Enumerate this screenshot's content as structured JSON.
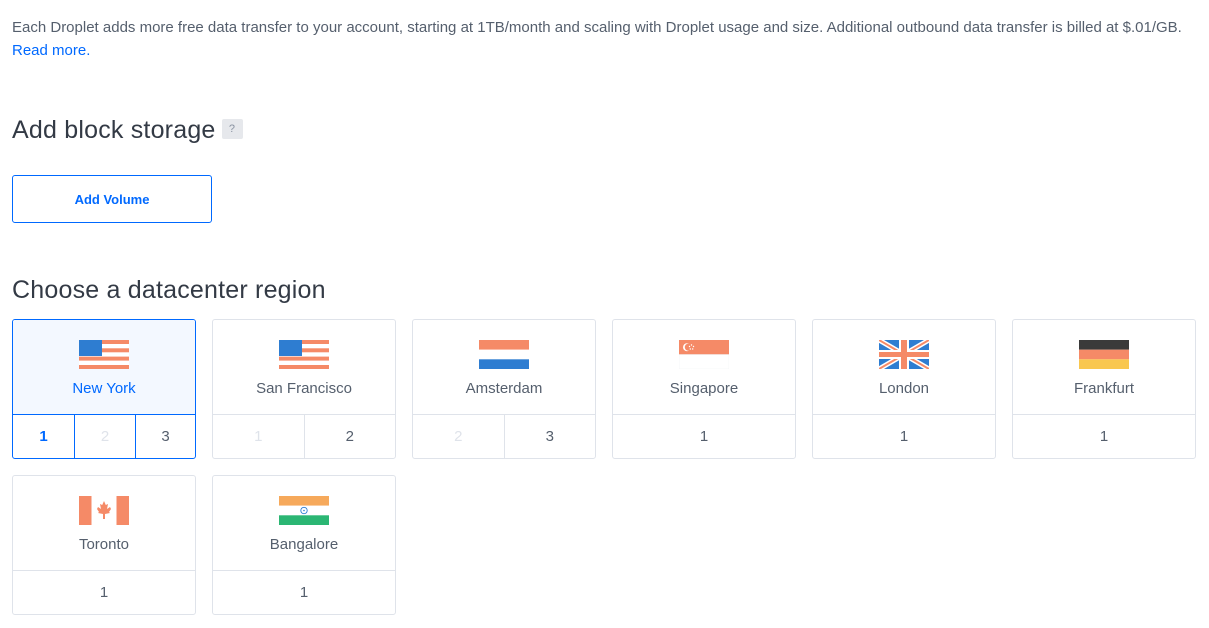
{
  "intro": {
    "text": "Each Droplet adds more free data transfer to your account, starting at 1TB/month and scaling with Droplet usage and size. Additional outbound data transfer is billed at $.01/GB.",
    "link": "Read more."
  },
  "block_storage": {
    "title": "Add block storage",
    "help": "?",
    "button": "Add Volume"
  },
  "region": {
    "title": "Choose a datacenter region",
    "cards": [
      {
        "city": "New York",
        "flag": "us-flag-icon",
        "options": [
          "1",
          "2",
          "3"
        ],
        "selected": "1"
      },
      {
        "city": "San Francisco",
        "flag": "us-flag-icon",
        "options": [
          "1",
          "2"
        ]
      },
      {
        "city": "Amsterdam",
        "flag": "netherlands-flag-icon",
        "options": [
          "2",
          "3"
        ]
      },
      {
        "city": "Singapore",
        "flag": "singapore-flag-icon",
        "options": [
          "1"
        ]
      },
      {
        "city": "London",
        "flag": "uk-flag-icon",
        "options": [
          "1"
        ]
      },
      {
        "city": "Frankfurt",
        "flag": "germany-flag-icon",
        "options": [
          "1"
        ]
      },
      {
        "city": "Toronto",
        "flag": "canada-flag-icon",
        "options": [
          "1"
        ]
      },
      {
        "city": "Bangalore",
        "flag": "india-flag-icon",
        "options": [
          "1"
        ]
      }
    ]
  },
  "colors": {
    "accent": "#0069ff",
    "border": "#dfe3ea",
    "selected_bg": "#f3f8ff",
    "flag_red": "#f58a67",
    "flag_blue": "#2e7dd1"
  }
}
